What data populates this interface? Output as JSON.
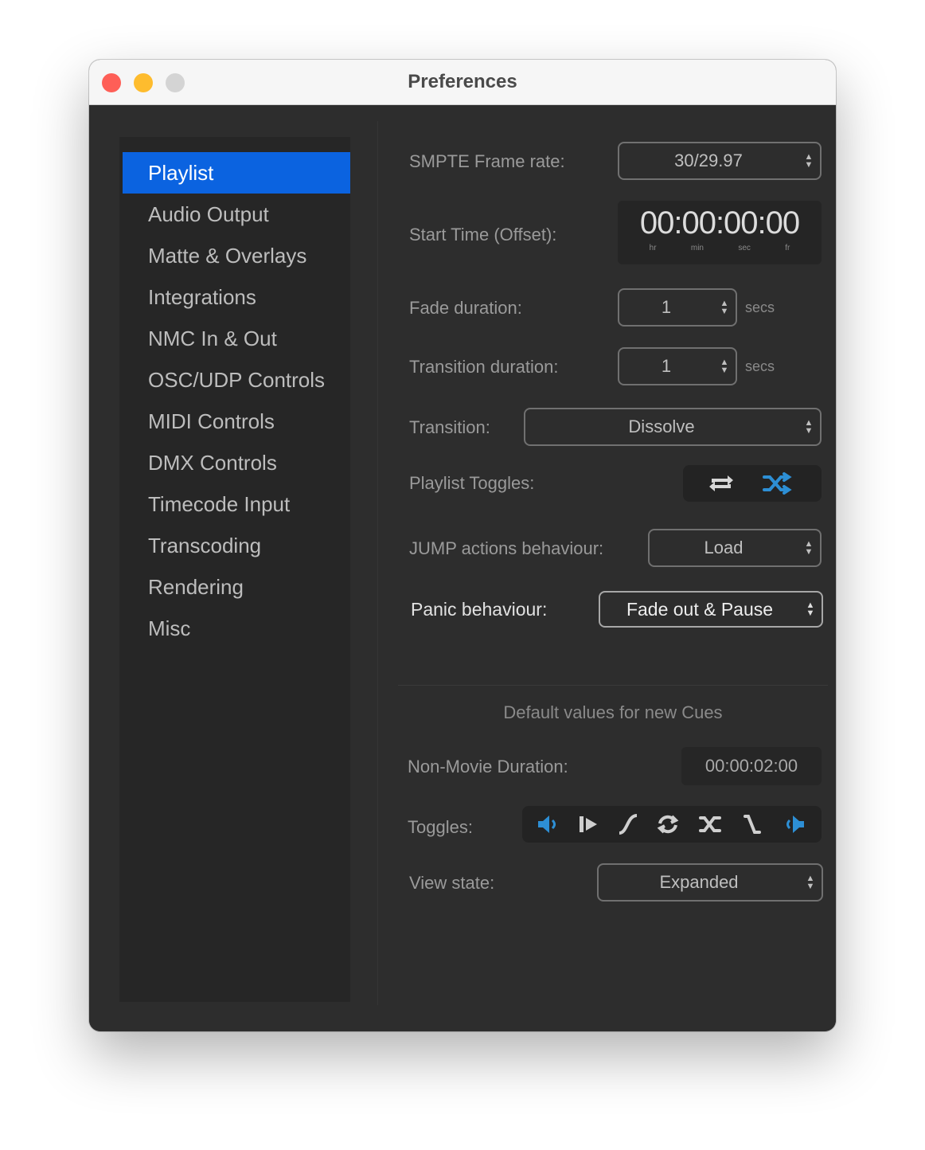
{
  "window": {
    "title": "Preferences"
  },
  "sidebar": {
    "items": [
      {
        "label": "Playlist",
        "selected": true
      },
      {
        "label": "Audio Output"
      },
      {
        "label": "Matte & Overlays"
      },
      {
        "label": "Integrations"
      },
      {
        "label": "NMC In & Out"
      },
      {
        "label": "OSC/UDP Controls"
      },
      {
        "label": "MIDI Controls"
      },
      {
        "label": "DMX Controls"
      },
      {
        "label": "Timecode Input"
      },
      {
        "label": "Transcoding"
      },
      {
        "label": "Rendering"
      },
      {
        "label": "Misc"
      }
    ]
  },
  "playlist": {
    "smpte": {
      "label": "SMPTE Frame rate:",
      "value": "30/29.97"
    },
    "start_time": {
      "label": "Start Time (Offset):",
      "value": "00:00:00:00",
      "units": [
        "hr",
        "min",
        "sec",
        "fr"
      ]
    },
    "fade": {
      "label": "Fade duration:",
      "value": "1",
      "unit": "secs"
    },
    "transition_duration": {
      "label": "Transition duration:",
      "value": "1",
      "unit": "secs"
    },
    "transition": {
      "label": "Transition:",
      "value": "Dissolve"
    },
    "toggles": {
      "label": "Playlist Toggles:",
      "icons": [
        "loop-icon",
        "shuffle-icon"
      ]
    },
    "jump": {
      "label": "JUMP actions behaviour:",
      "value": "Load"
    },
    "panic": {
      "label": "Panic behaviour:",
      "value": "Fade out & Pause"
    }
  },
  "defaults": {
    "title": "Default values for new Cues",
    "nonmovie": {
      "label": "Non-Movie Duration:",
      "value": "00:00:02:00"
    },
    "toggles": {
      "label": "Toggles:",
      "icons": [
        "audio-in-icon",
        "play-next-icon",
        "fade-curve-icon",
        "loop-icon",
        "shuffle-icon",
        "jump-icon",
        "audio-out-icon"
      ]
    },
    "view_state": {
      "label": "View state:",
      "value": "Expanded"
    }
  },
  "colors": {
    "accent": "#0b63e0",
    "toggle_on": "#2d8fd5",
    "background": "#2d2d2d"
  }
}
